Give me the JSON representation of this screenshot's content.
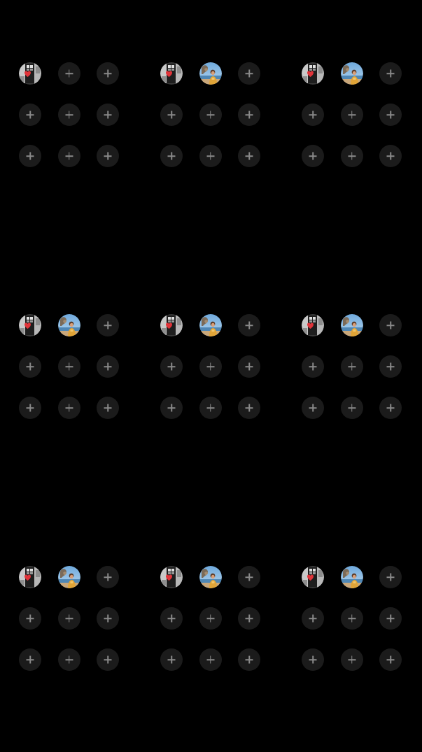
{
  "screen": {
    "background": "#000000"
  },
  "colors": {
    "slot_fill": "#1b1b1b",
    "plus_color": "#8a8a8a"
  },
  "panels": [
    {
      "id": "panel-1",
      "slots": [
        "avatar-heart-window",
        "add",
        "add",
        "add",
        "add",
        "add",
        "add",
        "add",
        "add"
      ]
    },
    {
      "id": "panel-2",
      "slots": [
        "avatar-heart-window",
        "avatar-beach-person",
        "add",
        "add",
        "add",
        "add",
        "add",
        "add",
        "add"
      ]
    },
    {
      "id": "panel-3",
      "slots": [
        "avatar-heart-window",
        "avatar-beach-person",
        "add",
        "add",
        "add",
        "add",
        "add",
        "add",
        "add"
      ]
    },
    {
      "id": "panel-4",
      "slots": [
        "avatar-heart-window",
        "avatar-beach-person",
        "add",
        "add",
        "add",
        "add",
        "add",
        "add",
        "add"
      ]
    },
    {
      "id": "panel-5",
      "slots": [
        "avatar-heart-window",
        "avatar-beach-person",
        "add",
        "add",
        "add",
        "add",
        "add",
        "add",
        "add"
      ]
    },
    {
      "id": "panel-6",
      "slots": [
        "avatar-heart-window",
        "avatar-beach-person",
        "add",
        "add",
        "add",
        "add",
        "add",
        "add",
        "add"
      ]
    },
    {
      "id": "panel-7",
      "slots": [
        "avatar-heart-window",
        "avatar-beach-person",
        "add",
        "add",
        "add",
        "add",
        "add",
        "add",
        "add"
      ]
    },
    {
      "id": "panel-8",
      "slots": [
        "avatar-heart-window",
        "avatar-beach-person",
        "add",
        "add",
        "add",
        "add",
        "add",
        "add",
        "add"
      ]
    },
    {
      "id": "panel-9",
      "slots": [
        "avatar-heart-window",
        "avatar-beach-person",
        "add",
        "add",
        "add",
        "add",
        "add",
        "add",
        "add"
      ]
    }
  ],
  "icons": {
    "add": "plus-icon",
    "avatar-heart-window": "heart-photo-avatar",
    "avatar-beach-person": "beach-photo-avatar"
  }
}
